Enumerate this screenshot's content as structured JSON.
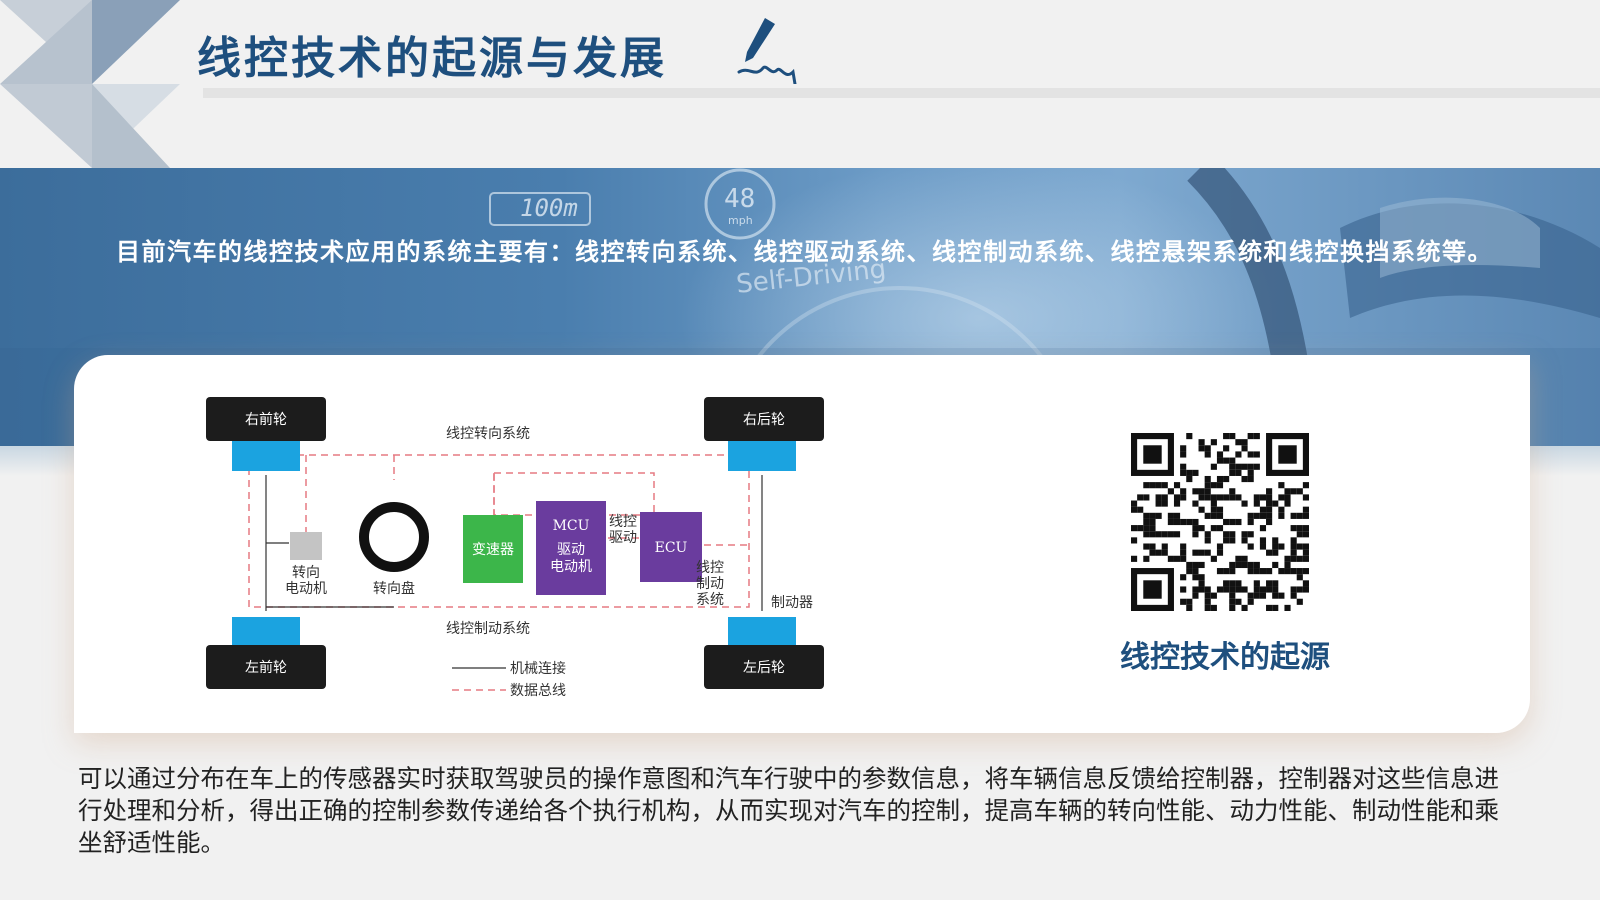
{
  "page": {
    "title": "线控技术的起源与发展",
    "intro": "目前汽车的线控技术应用的系统主要有：线控转向系统、线控驱动系统、线控制动系统、线控悬架系统和线控换挡系统等。",
    "banner_overlay": {
      "speed_sign": "100m",
      "speed_gauge": "48",
      "speed_unit": "mph",
      "self_driving": "Self-Driving"
    },
    "diagram": {
      "wheel_fr": "右前轮",
      "wheel_fl": "左前轮",
      "wheel_rr": "右后轮",
      "wheel_rl": "左后轮",
      "steer_system": "线控转向系统",
      "brake_system": "线控制动系统",
      "steer_motor_1": "转向",
      "steer_motor_2": "电动机",
      "steering_wheel": "转向盘",
      "gearbox": "变速器",
      "mcu_1": "MCU",
      "mcu_2": "驱动",
      "mcu_3": "电动机",
      "drive_1": "线控",
      "drive_2": "驱动",
      "ecu": "ECU",
      "brake_ctrl_1": "线控",
      "brake_ctrl_2": "制动",
      "brake_ctrl_3": "系统",
      "brake": "制动器",
      "legend_mech": "机械连接",
      "legend_bus": "数据总线"
    },
    "qr_caption": "线控技术的起源",
    "body": "可以通过分布在车上的传感器实时获取驾驶员的操作意图和汽车行驶中的参数信息，将车辆信息反馈给控制器，控制器对这些信息进行处理和分析，得出正确的控制参数传递给各个执行机构，从而实现对汽车的控制，提高车辆的转向性能、动力性能、制动性能和乘坐舒适性能。"
  },
  "colors": {
    "title": "#1e4f7e",
    "wheel_box": "#1c1c1c",
    "axle_block": "#1ba3e0",
    "gearbox": "#3cb64a",
    "controller": "#6a3c9e",
    "bus_line": "#e57a82"
  },
  "icons": [
    "pen-signature-icon",
    "qr-code"
  ]
}
